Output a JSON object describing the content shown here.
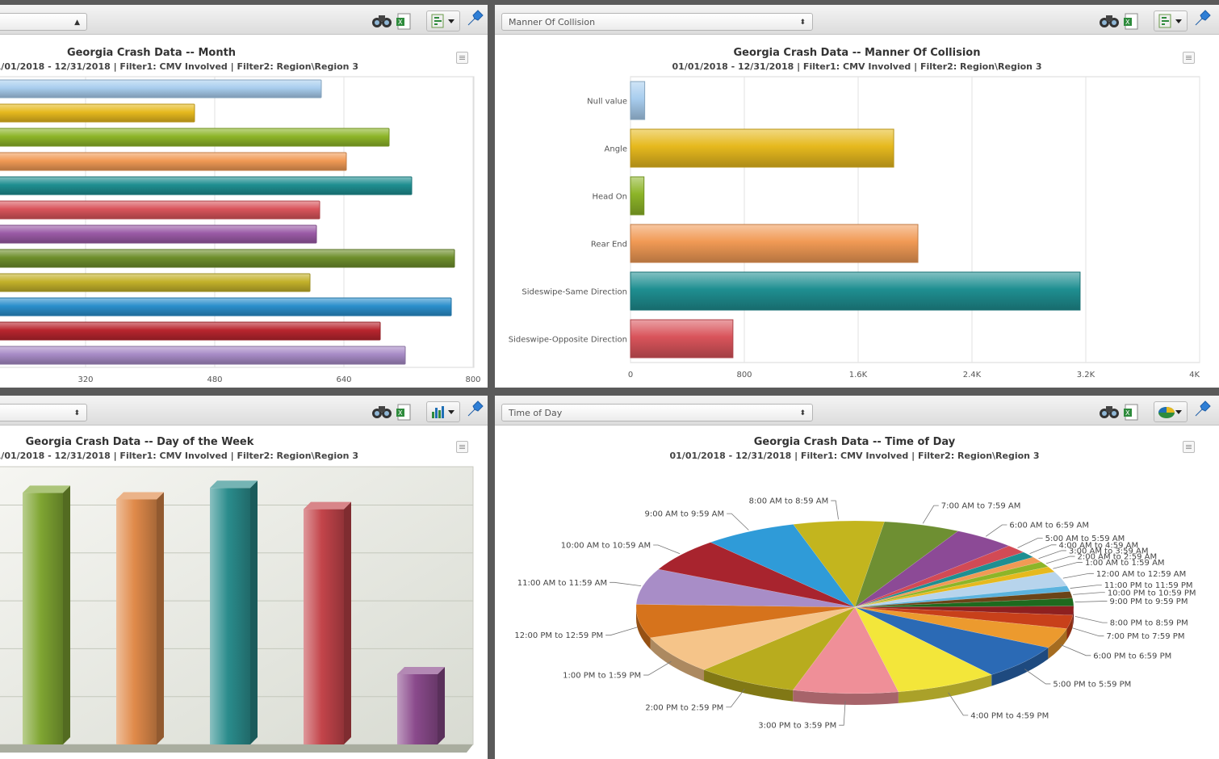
{
  "colors": {
    "palette": [
      "#a8cdee",
      "#e6b91e",
      "#8db528",
      "#f19a55",
      "#1f8f91",
      "#d9545b",
      "#9a5aa6",
      "#6e8f2c",
      "#c3b12a",
      "#2b8fcc",
      "#b8252e",
      "#a78bc6"
    ]
  },
  "panels": {
    "month": {
      "selector": "",
      "title": "Georgia Crash Data -- Month",
      "subtitle": "01/01/2018 - 12/31/2018 | Filter1: CMV Involved | Filter2: Region\\Region 3"
    },
    "collision": {
      "selector": "Manner Of Collision",
      "title": "Georgia Crash Data -- Manner Of Collision",
      "subtitle": "01/01/2018 - 12/31/2018 | Filter1: CMV Involved | Filter2: Region\\Region 3"
    },
    "weekday": {
      "selector": "",
      "title": "Georgia Crash Data -- Day of the Week",
      "subtitle": "01/01/2018 - 12/31/2018 | Filter1: CMV Involved | Filter2: Region\\Region 3"
    },
    "timeofday": {
      "selector": "Time of Day",
      "title": "Georgia Crash Data -- Time of Day",
      "subtitle": "01/01/2018 - 12/31/2018 | Filter1: CMV Involved | Filter2: Region\\Region 3"
    }
  },
  "toolbar_icons": [
    "binoculars-icon",
    "excel-export-icon",
    "chart-type-icon",
    "pin-icon"
  ],
  "chart_data": [
    {
      "id": "month",
      "type": "bar",
      "orientation": "horizontal",
      "title": "Georgia Crash Data -- Month",
      "xlim": [
        0,
        800
      ],
      "ticks": [
        {
          "value": 160,
          "label": ""
        },
        {
          "value": 320,
          "label": "320"
        },
        {
          "value": 480,
          "label": "480"
        },
        {
          "value": 640,
          "label": "640"
        },
        {
          "value": 800,
          "label": "800"
        }
      ],
      "values": [
        612,
        455,
        696,
        643,
        724,
        610,
        606,
        777,
        598,
        773,
        685,
        716
      ]
    },
    {
      "id": "collision",
      "type": "bar",
      "orientation": "horizontal",
      "title": "Georgia Crash Data -- Manner Of Collision",
      "categories": [
        "Null value",
        "Angle",
        "Head On",
        "Rear End",
        "Sideswipe-Same Direction",
        "Sideswipe-Opposite Direction"
      ],
      "values": [
        100,
        1850,
        95,
        2020,
        3160,
        720
      ],
      "xlim": [
        0,
        4000
      ],
      "ticks": [
        {
          "value": 0,
          "label": "0"
        },
        {
          "value": 800,
          "label": "800"
        },
        {
          "value": 1600,
          "label": "1.6K"
        },
        {
          "value": 2400,
          "label": "2.4K"
        },
        {
          "value": 3200,
          "label": "3.2K"
        },
        {
          "value": 4000,
          "label": "4K"
        }
      ]
    },
    {
      "id": "weekday",
      "type": "bar",
      "orientation": "vertical",
      "title": "Georgia Crash Data -- Day of the Week",
      "values": [
        308,
        300,
        314,
        288,
        86
      ],
      "ylim": [
        0,
        340
      ],
      "colors": [
        "#7fa532",
        "#e08a4a",
        "#2a8c8c",
        "#c3444a",
        "#8a4a8c"
      ]
    },
    {
      "id": "timeofday",
      "type": "pie",
      "title": "Georgia Crash Data -- Time of Day",
      "slices": [
        {
          "label": "12:00 AM to 12:59 AM",
          "value": 2.6,
          "color": "#b7d4ec"
        },
        {
          "label": "11:00 PM to 11:59 PM",
          "value": 1.0,
          "color": "#5bb3de"
        },
        {
          "label": "10:00 PM to 10:59 PM",
          "value": 1.2,
          "color": "#6b4418"
        },
        {
          "label": "9:00 PM to 9:59 PM",
          "value": 1.4,
          "color": "#1e6a1e"
        },
        {
          "label": "8:00 PM to 8:59 PM",
          "value": 1.6,
          "color": "#8e2020"
        },
        {
          "label": "7:00 PM to 7:59 PM",
          "value": 2.4,
          "color": "#c8401a"
        },
        {
          "label": "6:00 PM to 6:59 PM",
          "value": 3.6,
          "color": "#ec9a2e"
        },
        {
          "label": "5:00 PM to 5:59 PM",
          "value": 6.2,
          "color": "#2b6ab5"
        },
        {
          "label": "4:00 PM to 4:59 PM",
          "value": 7.2,
          "color": "#f3e63a"
        },
        {
          "label": "3:00 PM to 3:59 PM",
          "value": 7.4,
          "color": "#ef8f98"
        },
        {
          "label": "2:00 PM to 2:59 PM",
          "value": 7.2,
          "color": "#b8ac1e"
        },
        {
          "label": "1:00 PM to 1:59 PM",
          "value": 6.8,
          "color": "#f5c489"
        },
        {
          "label": "12:00 PM to 12:59 PM",
          "value": 6.0,
          "color": "#d6731c"
        },
        {
          "label": "11:00 AM to 11:59 AM",
          "value": 6.4,
          "color": "#a88dc7"
        },
        {
          "label": "10:00 AM to 10:59 AM",
          "value": 6.0,
          "color": "#a8242e"
        },
        {
          "label": "9:00 AM to 9:59 AM",
          "value": 6.6,
          "color": "#2f9bd8"
        },
        {
          "label": "8:00 AM to 8:59 AM",
          "value": 6.4,
          "color": "#c3b51e"
        },
        {
          "label": "7:00 AM to 7:59 AM",
          "value": 5.4,
          "color": "#6e8f32"
        },
        {
          "label": "6:00 AM to 6:59 AM",
          "value": 4.4,
          "color": "#8c4a96"
        },
        {
          "label": "5:00 AM to 5:59 AM",
          "value": 1.5,
          "color": "#d24a55"
        },
        {
          "label": "4:00 AM to 4:59 AM",
          "value": 1.1,
          "color": "#1f8f91"
        },
        {
          "label": "3:00 AM to 3:59 AM",
          "value": 1.0,
          "color": "#f19a55"
        },
        {
          "label": "2:00 AM to 2:59 AM",
          "value": 1.0,
          "color": "#8db528"
        },
        {
          "label": "1:00 AM to 1:59 AM",
          "value": 1.0,
          "color": "#e6b91e"
        }
      ]
    }
  ]
}
